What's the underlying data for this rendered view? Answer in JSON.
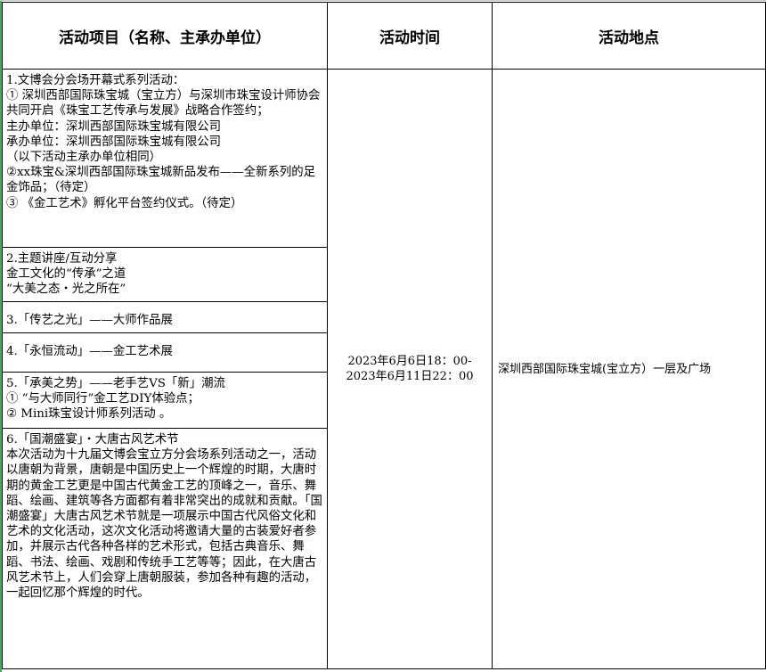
{
  "headers": {
    "project": "活动项目（名称、主承办单位）",
    "time": "活动时间",
    "place": "活动地点"
  },
  "items": [
    {
      "lines": [
        "1.文博会分会场开幕式系列活动：",
        "① 深圳西部国际珠宝城（宝立方）与深圳市珠宝设计师协会共同开启《珠宝工艺传承与发展》战略合作签约；",
        "主办单位：深圳西部国际珠宝城有限公司",
        "承办单位：深圳西部国际珠宝城有限公司",
        "（以下活动主承办单位相同）",
        "②xx珠宝&深圳西部国际珠宝城新品发布——全新系列的足金饰品；（待定）",
        "③ 《金工艺术》孵化平台签约仪式。（待定）"
      ]
    },
    {
      "lines": [
        "2.主题讲座/互动分享",
        "金工文化的“传承”之道",
        "“大美之态・光之所在”"
      ]
    },
    {
      "lines": [
        "3.「传艺之光」——大师作品展"
      ]
    },
    {
      "lines": [
        "4.「永恒流动」——金工艺术展"
      ]
    },
    {
      "lines": [
        "5.「承美之势」——老手艺VS「新」潮流",
        "① “与大师同行”金工艺DIY体验点；",
        "②  Mini珠宝设计师系列活动 。"
      ]
    },
    {
      "lines": [
        "6.「国潮盛宴」・大唐古风艺术节",
        "本次活动为十九届文博会宝立方分会场系列活动之一，活动以唐朝为背景，唐朝是中国历史上一个辉煌的时期，大唐时期的黄金工艺更是中国古代黄金工艺的顶峰之一，音乐、舞蹈、绘画、建筑等各方面都有着非常突出的成就和贡献。「国潮盛宴」大唐古风艺术节就是一项展示中国古代风俗文化和艺术的文化活动，这次文化活动将邀请大量的古装爱好者参加，并展示古代各种各样的艺术形式，包括古典音乐、舞蹈、书法、绘画、戏剧和传统手工艺等等；因此，在大唐古风艺术节上，人们会穿上唐朝服装，参加各种有趣的活动，一起回忆那个辉煌的时代。"
      ]
    }
  ],
  "time": {
    "start": "2023年6月6日18：00-",
    "end": "2023年6月11日22：00"
  },
  "place": "深圳西部国际珠宝城(宝立方）一层及广场"
}
